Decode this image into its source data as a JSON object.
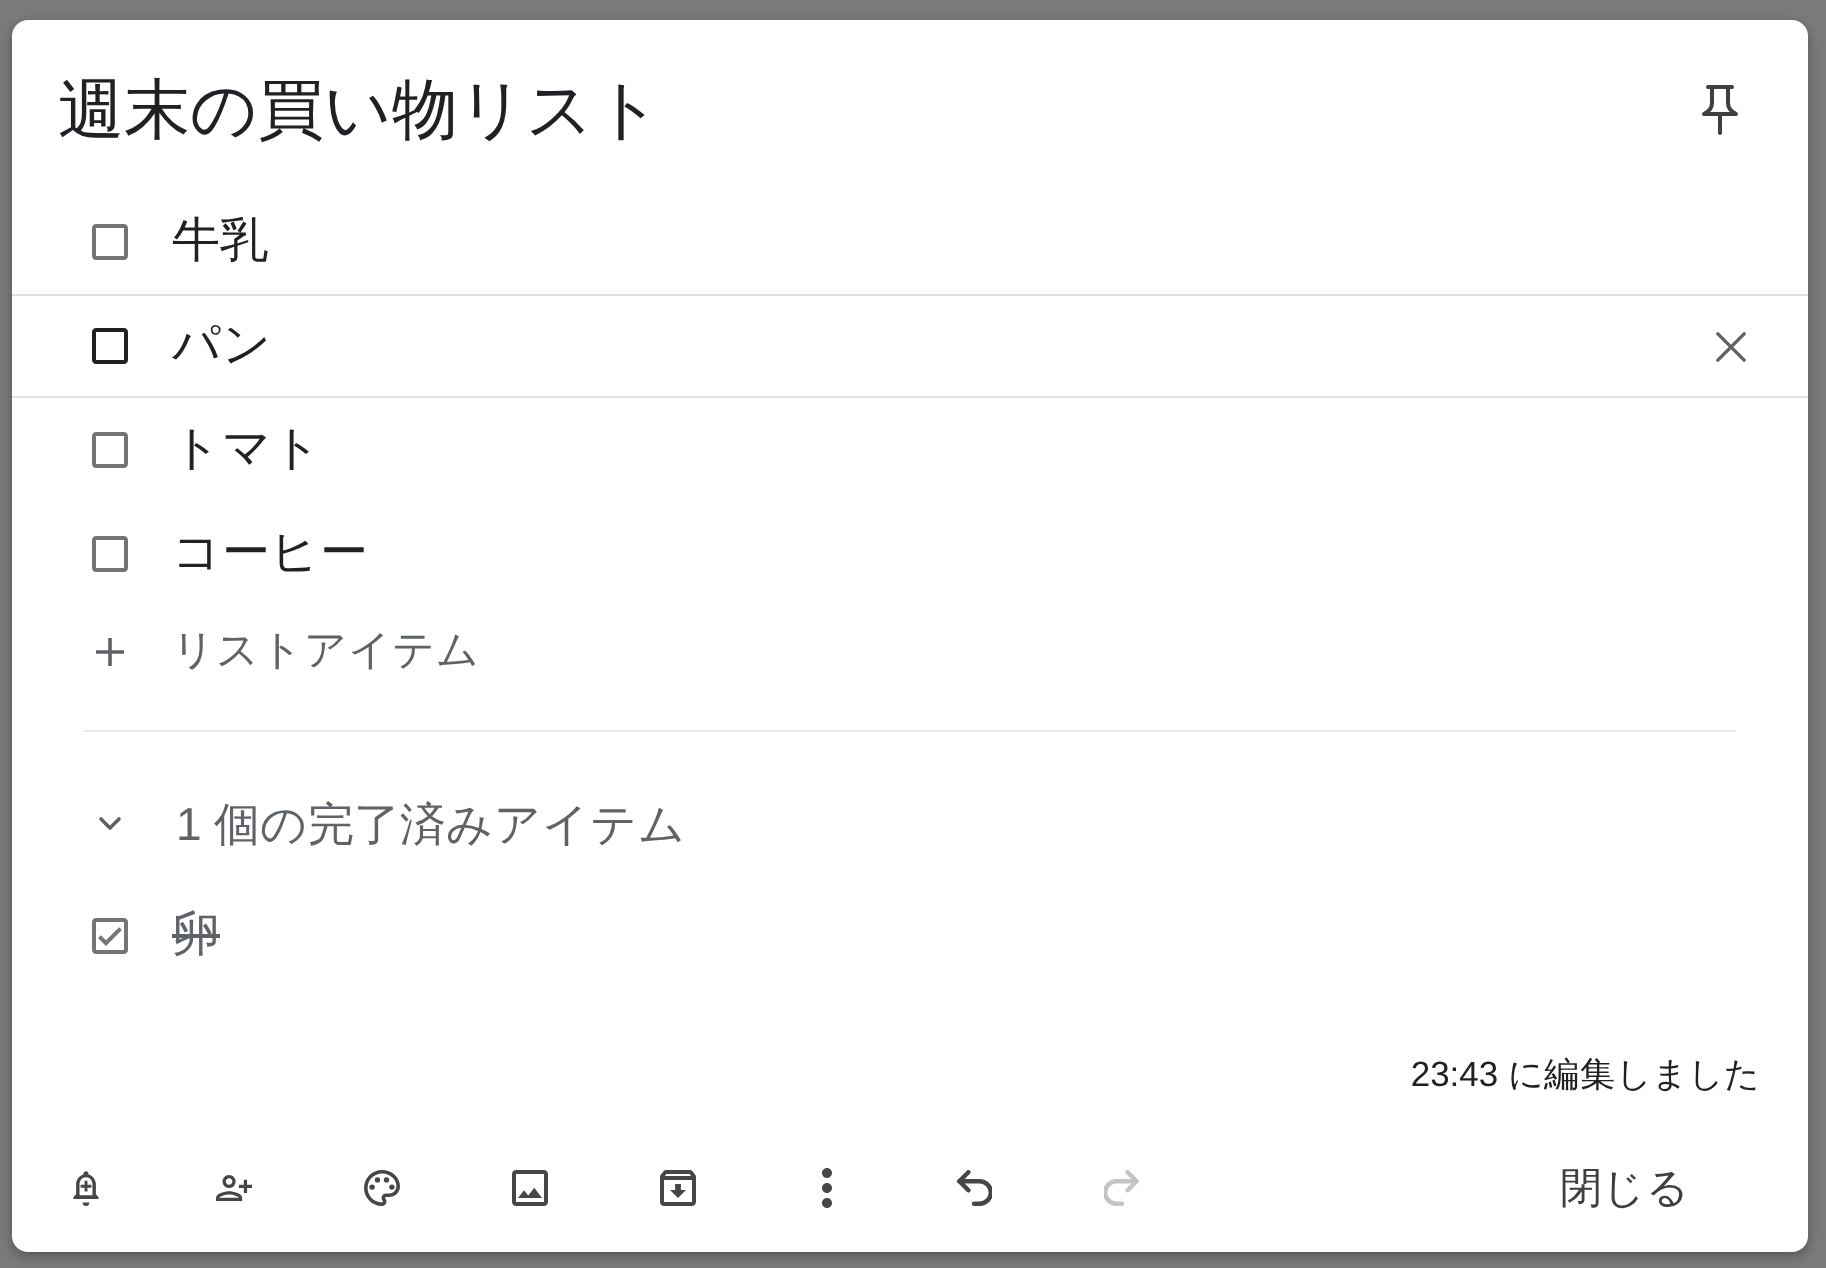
{
  "note": {
    "title": "週末の買い物リスト"
  },
  "items": [
    {
      "text": "牛乳",
      "checked": false,
      "focused": false
    },
    {
      "text": "パン",
      "checked": false,
      "focused": true
    },
    {
      "text": "トマト",
      "checked": false,
      "focused": false
    },
    {
      "text": "コーヒー",
      "checked": false,
      "focused": false
    }
  ],
  "add_item": {
    "placeholder": "リストアイテム"
  },
  "completed": {
    "label": "1 個の完了済みアイテム",
    "expanded": true,
    "items": [
      {
        "text": "卵",
        "checked": true
      }
    ]
  },
  "edited": "23:43 に編集しました",
  "toolbar": {
    "buttons": [
      {
        "kind": "reminder",
        "disabled": false
      },
      {
        "kind": "collaborator",
        "disabled": false
      },
      {
        "kind": "palette",
        "disabled": false
      },
      {
        "kind": "image",
        "disabled": false
      },
      {
        "kind": "archive",
        "disabled": false
      },
      {
        "kind": "more",
        "disabled": false
      },
      {
        "kind": "undo",
        "disabled": false
      },
      {
        "kind": "redo",
        "disabled": true
      }
    ],
    "close": "閉じる"
  }
}
